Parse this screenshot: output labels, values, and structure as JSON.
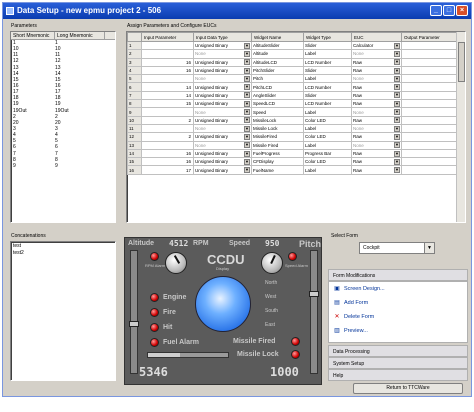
{
  "window": {
    "title": "Data Setup - new epmu project 2 - 506",
    "minimize": "_",
    "maximize": "□",
    "close": "×"
  },
  "parameters": {
    "label": "Parameters",
    "headers": [
      "Short Mnemonic",
      "Long Mnemonic"
    ],
    "rows": [
      [
        "10",
        "10"
      ],
      [
        "11",
        "11"
      ],
      [
        "12",
        "12"
      ],
      [
        "13",
        "13"
      ],
      [
        "14",
        "14"
      ],
      [
        "15",
        "15"
      ],
      [
        "16",
        "16"
      ],
      [
        "17",
        "17"
      ],
      [
        "18",
        "18"
      ],
      [
        "19",
        "19"
      ],
      [
        "19Out",
        "19Out"
      ],
      [
        "2",
        "2"
      ],
      [
        "20",
        "20"
      ],
      [
        "3",
        "3"
      ],
      [
        "4",
        "4"
      ],
      [
        "5",
        "5"
      ],
      [
        "6",
        "6"
      ],
      [
        "7",
        "7"
      ],
      [
        "8",
        "8"
      ],
      [
        "9",
        "9"
      ]
    ],
    "first_row": [
      "1",
      "1"
    ]
  },
  "assign": {
    "label": "Assign Parameters and Configure EUCs",
    "headers": [
      "",
      "Input Parameter",
      "Input Data Type",
      "Widget Name",
      "Widget Type",
      "EUC",
      "Output Parameter"
    ],
    "rows": [
      {
        "n": "1",
        "param": "",
        "dtype": "Unsigned Binary",
        "wname": "AltitudeSlider",
        "wtype": "Slider",
        "euc": "Calculator"
      },
      {
        "n": "2",
        "param": "",
        "dtype": "None",
        "wname": "Altitude",
        "wtype": "Label",
        "euc": "None"
      },
      {
        "n": "3",
        "param": "16",
        "dtype": "Unsigned Binary",
        "wname": "AltitudeLCD",
        "wtype": "LCD Number",
        "euc": "Raw"
      },
      {
        "n": "4",
        "param": "16",
        "dtype": "Unsigned Binary",
        "wname": "PitchSlider",
        "wtype": "Slider",
        "euc": "Raw"
      },
      {
        "n": "5",
        "param": "",
        "dtype": "None",
        "wname": "Pitch",
        "wtype": "Label",
        "euc": "None"
      },
      {
        "n": "6",
        "param": "14",
        "dtype": "Unsigned Binary",
        "wname": "PitchLCD",
        "wtype": "LCD Number",
        "euc": "Raw"
      },
      {
        "n": "7",
        "param": "14",
        "dtype": "Unsigned Binary",
        "wname": "AngleSlider",
        "wtype": "Slider",
        "euc": "Raw"
      },
      {
        "n": "8",
        "param": "15",
        "dtype": "Unsigned Binary",
        "wname": "SpeedLCD",
        "wtype": "LCD Number",
        "euc": "Raw"
      },
      {
        "n": "9",
        "param": "",
        "dtype": "None",
        "wname": "Speed",
        "wtype": "Label",
        "euc": "None"
      },
      {
        "n": "10",
        "param": "2",
        "dtype": "Unsigned Binary",
        "wname": "MissileLock",
        "wtype": "Color LED",
        "euc": "Raw"
      },
      {
        "n": "11",
        "param": "",
        "dtype": "None",
        "wname": "Missile Lock",
        "wtype": "Label",
        "euc": "None"
      },
      {
        "n": "12",
        "param": "2",
        "dtype": "Unsigned Binary",
        "wname": "MissileFired",
        "wtype": "Color LED",
        "euc": "Raw"
      },
      {
        "n": "13",
        "param": "",
        "dtype": "None",
        "wname": "Missile Fired",
        "wtype": "Label",
        "euc": "None"
      },
      {
        "n": "14",
        "param": "16",
        "dtype": "Unsigned Binary",
        "wname": "FuelProgress",
        "wtype": "Progress Bar",
        "euc": "Raw"
      },
      {
        "n": "15",
        "param": "16",
        "dtype": "Unsigned Binary",
        "wname": "CFDisplay",
        "wtype": "Color LED",
        "euc": "Raw"
      },
      {
        "n": "16",
        "param": "17",
        "dtype": "Unsigned Binary",
        "wname": "FuelName",
        "wtype": "Label",
        "euc": "Raw"
      }
    ]
  },
  "concatenations": {
    "label": "Concatenations",
    "items": [
      "test",
      "test2"
    ]
  },
  "ccdu": {
    "altitude": "Altitude",
    "speed": "Speed",
    "pitch": "Pitch",
    "rpm": "RPM",
    "rpm_value": "4512",
    "speed_value": "950",
    "title": "CCDU",
    "display": "Display",
    "rpm_alarm": "RPM Alarm",
    "speed_alarm": "Speed Alarm",
    "engine": "Engine",
    "fire": "Fire",
    "hit": "Hit",
    "fuel_alarm": "Fuel Alarm",
    "north": "North",
    "west": "West",
    "south": "South",
    "east": "East",
    "missile_fired": "Missile Fired",
    "missile_lock": "Missile Lock",
    "lcd_left": "5346",
    "lcd_right": "1000"
  },
  "select_form": {
    "label": "Select Form",
    "value": "Cockpit"
  },
  "form_mods": {
    "label": "Form Modifications",
    "items": [
      "Screen Design...",
      "Add Form",
      "Delete Form",
      "Preview..."
    ]
  },
  "sections": [
    "Data Processing",
    "System Setup",
    "Help"
  ],
  "return_button": "Return to TTCWare",
  "colors": {
    "titlebar": "#0a3cb0",
    "led": "#d00000",
    "ccdu_bg": "#5b5b5b",
    "sphere": "#3f8fff"
  }
}
